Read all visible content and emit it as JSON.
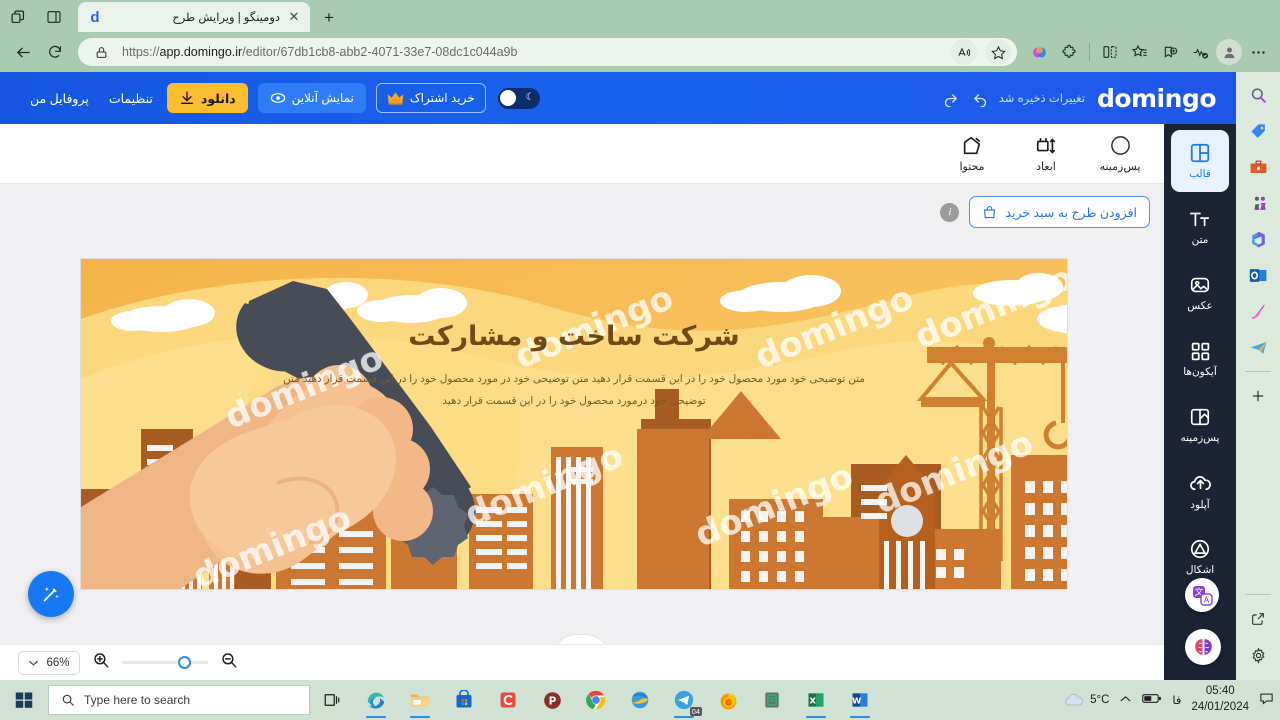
{
  "browser": {
    "tab": {
      "title": "دومینگو | ویرایش طرح",
      "favicon_letter": "d"
    },
    "tabstrip_icons": [
      "tab-actions-icon",
      "tab-list-icon"
    ],
    "newtab_label": "+",
    "nav": {
      "back": "back-arrow-icon",
      "reload": "reload-icon"
    },
    "address": {
      "lock": "lock-icon",
      "url_prefix": "https://",
      "url_main": "app.domingo.ir",
      "url_path": "/editor/67db1cb8-abb2-4071-33e7-08dc1c044a9b",
      "read_aloud": "read-aloud-icon",
      "favorite": "star-icon"
    },
    "toolbar_icons": [
      "copilot-icon",
      "extensions-icon",
      "split-screen-icon",
      "collections-icon",
      "add-favorite-icon",
      "browser-essentials-icon",
      "profile-icon",
      "settings-more-icon"
    ],
    "sidebar_icons": [
      "search-icon",
      "shopping-tag-icon",
      "tools-icon",
      "games-icon",
      "microsoft-365-icon",
      "outlook-icon",
      "image-creator-icon",
      "telegram-icon",
      "add-sidebar-icon",
      "open-in-new-icon",
      "sidebar-settings-icon"
    ]
  },
  "app_header": {
    "logo": "domingo",
    "saved_text": "تغییرات ذخیره شد",
    "undo_icon": "undo-icon",
    "redo_icon": "redo-icon",
    "theme_toggle": {
      "name": "dark-mode-toggle",
      "state": "off"
    },
    "subscribe_button": "خرید اشتراک",
    "subscribe_icon": "crown-icon",
    "preview_button": "نمایش آنلاین",
    "preview_icon": "eye-icon",
    "download_button": "دانلود",
    "download_icon": "download-icon",
    "settings_link": "تنظیمات",
    "profile_link": "پروفایل من"
  },
  "edit_toolbar": {
    "items": [
      {
        "label": "پس‌زمینه",
        "icon": "circle-swatch-icon"
      },
      {
        "label": "ابعاد",
        "icon": "resize-icon"
      },
      {
        "label": "محتوا",
        "icon": "edit-pencil-icon"
      }
    ]
  },
  "canvas": {
    "cart_button": "افزودن طرح به سبد خرید",
    "cart_icon": "shopping-bag-icon",
    "info_icon": "i",
    "magic_button": "magic-wand-icon",
    "collapse_icon": "chevron-up-icon",
    "banner": {
      "title": "شرکت ساخت و مشارکت",
      "body": "متن توضیحی خود مورد محصول خود را در این قسمت قرار دهید  متن توضیحی خود در مورد محصول خود را در این قسمت قرار دهید متن توضیحی خود درمورد محصول خود را در این قسمت قرار دهید",
      "watermark": "domingo"
    }
  },
  "zoom_bar": {
    "level": "66%",
    "chevron_icon": "chevron-down-icon",
    "zoom_in_icon": "zoom-in-icon",
    "zoom_out_icon": "zoom-out-icon",
    "slider_name": "zoom-slider"
  },
  "right_rail": {
    "items": [
      {
        "label": "قالب",
        "icon": "template-icon",
        "active": true
      },
      {
        "label": "متن",
        "icon": "text-icon",
        "active": false
      },
      {
        "label": "عکس",
        "icon": "image-icon",
        "active": false
      },
      {
        "label": "آیکون‌ها",
        "icon": "icons-grid-icon",
        "active": false
      },
      {
        "label": "پس‌زمینه",
        "icon": "background-icon",
        "active": false
      },
      {
        "label": "آپلود",
        "icon": "upload-cloud-icon",
        "active": false
      },
      {
        "label": "اشکال",
        "icon": "shapes-icon",
        "active": false
      }
    ],
    "fab_translate": "translate-icon",
    "fab_ai": "ai-brain-icon"
  },
  "taskbar": {
    "start_icon": "windows-start-icon",
    "search_placeholder": "Type here to search",
    "search_icon": "search-icon",
    "task_view_icon": "task-view-icon",
    "apps": [
      "edge-icon",
      "file-explorer-icon",
      "microsoft-store-icon",
      "camtasia-icon",
      "photoscape-icon",
      "chrome-icon",
      "internet-explorer-icon",
      "telegram-icon",
      "firefox-icon",
      "notepad-icon",
      "excel-icon",
      "word-icon"
    ],
    "telegram_badge": "04",
    "weather_temp": "5°C",
    "weather_icon": "cloud-icon",
    "tray_icons": [
      "show-hidden-icons-icon",
      "battery-icon",
      "language-indicator"
    ],
    "language": "فا",
    "time": "05:40",
    "date": "24/01/2024",
    "notification_icon": "notification-icon"
  },
  "colors": {
    "app_blue": "#1a63ef",
    "accent_yellow": "#fbbc2e",
    "rail_dark": "#1b2335",
    "rail_active_bg": "#e8f1fe",
    "banner_sky": "#f6b54a",
    "banner_sun": "#fadc88",
    "building_dark": "#a9561f",
    "building_light": "#cd7832",
    "chrome_green": "#a8cbb1"
  }
}
